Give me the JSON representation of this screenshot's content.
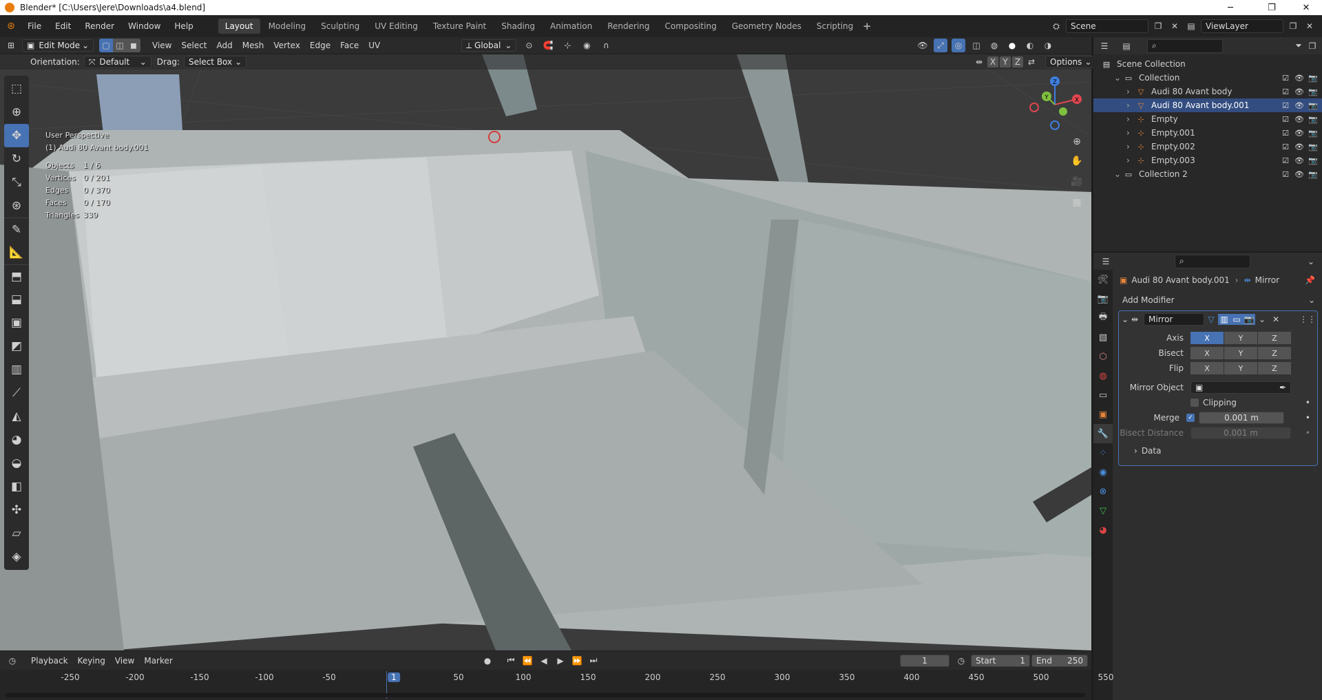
{
  "window": {
    "title": "Blender* [C:\\Users\\Jere\\Downloads\\a4.blend]"
  },
  "menu": [
    "File",
    "Edit",
    "Render",
    "Window",
    "Help"
  ],
  "workspaces": [
    "Layout",
    "Modeling",
    "Sculpting",
    "UV Editing",
    "Texture Paint",
    "Shading",
    "Animation",
    "Rendering",
    "Compositing",
    "Geometry Nodes",
    "Scripting"
  ],
  "active_workspace": "Layout",
  "scene": {
    "name": "Scene",
    "view_layer": "ViewLayer"
  },
  "viewport": {
    "mode": "Edit Mode",
    "menus": [
      "View",
      "Select",
      "Add",
      "Mesh",
      "Vertex",
      "Edge",
      "Face",
      "UV"
    ],
    "transform_orientation": "Global",
    "orientation_label": "Orientation:",
    "orientation_value": "Default",
    "drag_label": "Drag:",
    "drag_value": "Select Box",
    "axis_x": "X",
    "axis_y": "Y",
    "axis_z": "Z",
    "options_label": "Options",
    "perspective": "User Perspective",
    "object_label": "(1) Audi 80 Avant body.001",
    "stats": [
      {
        "label": "Objects",
        "value": "1 / 6"
      },
      {
        "label": "Vertices",
        "value": "0 / 201"
      },
      {
        "label": "Edges",
        "value": "0 / 370"
      },
      {
        "label": "Faces",
        "value": "0 / 170"
      },
      {
        "label": "Triangles",
        "value": "339"
      }
    ],
    "gizmo": {
      "x": "X",
      "y": "Y",
      "z": "Z"
    }
  },
  "outliner": {
    "rows": [
      {
        "name": "Scene Collection",
        "indent": 0,
        "type": "scene"
      },
      {
        "name": "Collection",
        "indent": 1,
        "type": "collection"
      },
      {
        "name": "Audi 80 Avant body",
        "indent": 2,
        "type": "mesh"
      },
      {
        "name": "Audi 80 Avant body.001",
        "indent": 2,
        "type": "mesh",
        "selected": true
      },
      {
        "name": "Empty",
        "indent": 2,
        "type": "empty"
      },
      {
        "name": "Empty.001",
        "indent": 2,
        "type": "empty"
      },
      {
        "name": "Empty.002",
        "indent": 2,
        "type": "empty"
      },
      {
        "name": "Empty.003",
        "indent": 2,
        "type": "empty"
      },
      {
        "name": "Collection 2",
        "indent": 1,
        "type": "collection"
      }
    ]
  },
  "properties": {
    "breadcrumb_object": "Audi 80 Avant body.001",
    "breadcrumb_modifier": "Mirror",
    "add_modifier": "Add Modifier",
    "modifier_name": "Mirror",
    "axis_label": "Axis",
    "bisect_label": "Bisect",
    "flip_label": "Flip",
    "mirror_object_label": "Mirror Object",
    "clipping_label": "Clipping",
    "merge_label": "Merge",
    "merge_value": "0.001 m",
    "bisect_distance_label": "Bisect Distance",
    "bisect_distance_value": "0.001 m",
    "data_label": "Data"
  },
  "timeline": {
    "menus": [
      "Playback",
      "Keying",
      "View",
      "Marker"
    ],
    "current_frame": "1",
    "start_label": "Start",
    "start": "1",
    "end_label": "End",
    "end": "250",
    "ticks": [
      "-250",
      "-200",
      "-150",
      "-100",
      "-50",
      "1",
      "50",
      "100",
      "150",
      "200",
      "250",
      "300",
      "350",
      "400",
      "450",
      "500",
      "550"
    ]
  },
  "colors": {
    "accent": "#4772b3",
    "selection_row": "#334d80",
    "x_axis": "#e0474f",
    "y_axis": "#7fbf3f",
    "z_axis": "#3f7fe0"
  }
}
